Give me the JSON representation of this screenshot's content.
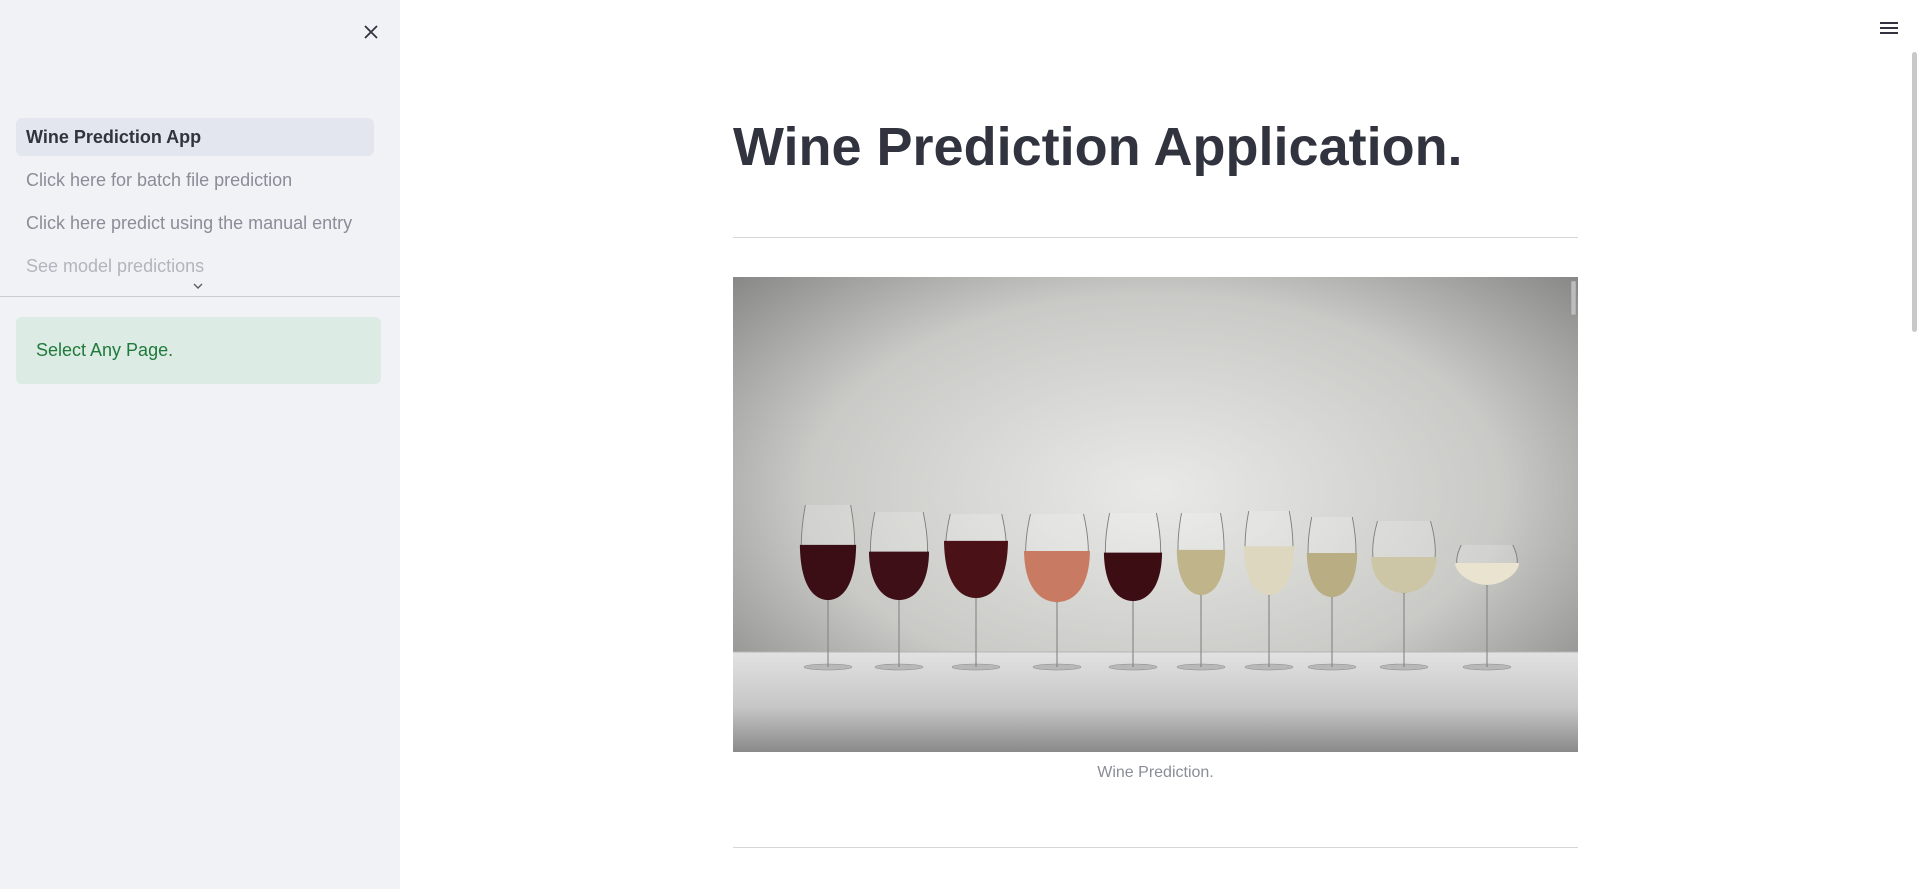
{
  "sidebar": {
    "close_icon": "close-icon",
    "nav_items": [
      {
        "label": "Wine Prediction App",
        "active": true
      },
      {
        "label": "Click here for batch file prediction",
        "active": false
      },
      {
        "label": "Click here predict using the manual entry",
        "active": false
      },
      {
        "label": "See model predictions",
        "active": false
      }
    ],
    "expand_icon": "chevron-down-icon",
    "alert": {
      "text": "Select Any Page.",
      "color": "#1f7a3a",
      "background": "#dcebe4"
    }
  },
  "main": {
    "menu_icon": "hamburger-menu-icon",
    "title": "Wine Prediction Application.",
    "image": {
      "caption": "Wine Prediction."
    }
  }
}
